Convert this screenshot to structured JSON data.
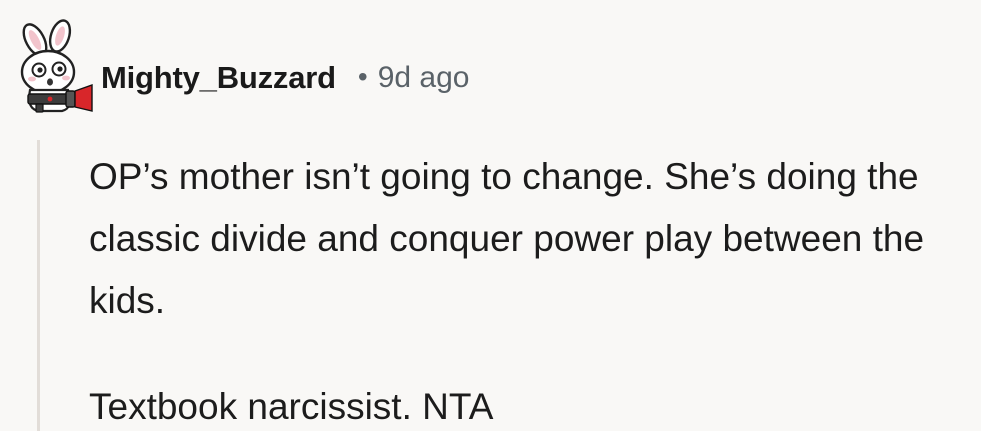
{
  "comment": {
    "author": "Mighty_Buzzard",
    "separator": "•",
    "age": "9d ago",
    "avatar_icon": "bunny-with-blaster-icon",
    "paragraphs": [
      "OP’s mother isn’t going to change. She’s doing the classic divide and conquer power play between the kids.",
      "Textbook narcissist. NTA"
    ]
  },
  "colors": {
    "background": "#f9f8f6",
    "text": "#1c1c1c",
    "meta": "#5a6268",
    "thread_line": "#e2ddd8",
    "blaster_red": "#d8262a"
  }
}
